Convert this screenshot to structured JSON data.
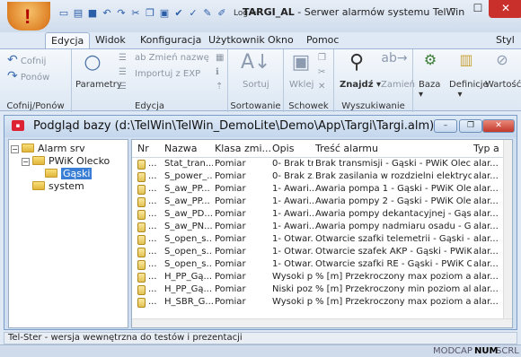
{
  "app": {
    "title_prefix": "TARGI_AL",
    "title_rest": " - Serwer alarmów systemu TelWin",
    "qat_log": "Log ="
  },
  "window_controls": {
    "minimize": "–",
    "maximize": "☐",
    "close": "✕"
  },
  "tabs": [
    "Edycja",
    "Widok",
    "Konfiguracja",
    "Użytkownik",
    "Okno",
    "Pomoc"
  ],
  "style_label": "Styl",
  "ribbon": {
    "cofnij": "Cofnij",
    "ponow": "Ponów",
    "group_cofnij": "Cofnij/Ponów",
    "parametry": "Parametry",
    "zmien_nazwe": "Zmień nazwę",
    "importuj": "Importuj z EXP",
    "group_edycja": "Edycja",
    "sortuj": "Sortuj",
    "group_sortowanie": "Sortowanie",
    "wklej": "Wklej",
    "group_schowek": "Schowek",
    "znajdz": "Znajdź",
    "zamien": "Zamień",
    "group_wyszukiwanie": "Wyszukiwanie",
    "baza": "Baza",
    "definicje": "Definicje",
    "wartosc": "Wartość"
  },
  "mdi": {
    "title": "Podgląd bazy (d:\\TelWin\\TelWin_DemoLite\\Demo\\App\\Targi\\Targi.alm)"
  },
  "tree": {
    "root": "Alarm srv",
    "child": "PWiK Olecko",
    "leaf": "Gąski",
    "system": "system"
  },
  "columns": [
    "Nr",
    "Nazwa",
    "Klasa zmi...",
    "Opis",
    "Treść alarmu",
    "Typ a"
  ],
  "rows": [
    [
      "...",
      "Stat_tran...",
      "Pomiar",
      "0- Brak tr...",
      "Brak transmisji - Gąski - PWiK Olecko",
      "alar..."
    ],
    [
      "...",
      "S_power_...",
      "Pomiar",
      "0- Brak z...",
      "Brak zasilania w rozdzielni elektrycznej - Gą...",
      "alar..."
    ],
    [
      "...",
      "S_aw_PP...",
      "Pomiar",
      "1- Awari...",
      "Awaria pompa 1 - Gąski - PWiK Olecko",
      "alar..."
    ],
    [
      "...",
      "S_aw_PP...",
      "Pomiar",
      "1- Awari...",
      "Awaria pompy 2 - Gąski - PWiK Olecko",
      "alar..."
    ],
    [
      "...",
      "S_aw_PD...",
      "Pomiar",
      "1- Awari...",
      "Awaria pompy dekantacyjnej - Gąski - PWi...",
      "alar..."
    ],
    [
      "...",
      "S_aw_PN...",
      "Pomiar",
      "1- Awari...",
      "Awaria pompy nadmiaru osadu - Gąski - P...",
      "alar..."
    ],
    [
      "...",
      "S_open_s...",
      "Pomiar",
      "1- Otwar...",
      "Otwarcie szafki telemetrii - Gąski - PWiK Ol...",
      "alar..."
    ],
    [
      "...",
      "S_open_s...",
      "Pomiar",
      "1- Otwar...",
      "Otwarcie szafek AKP - Gąski - PWiK Olecko",
      "alar..."
    ],
    [
      "...",
      "S_open_s...",
      "Pomiar",
      "1- Otwar...",
      "Otwarcie szafki RE - Gąski - PWiK Olecko",
      "alar..."
    ],
    [
      "...",
      "H_PP_Gą...",
      "Pomiar",
      "Wysoki p...",
      "% [m] Przekroczony max poziom alarmowy...",
      "alar..."
    ],
    [
      "...",
      "H_PP_Gą...",
      "Pomiar",
      "Niski poz...",
      "% [m] Przekroczony min poziom alarmowy...",
      "alar..."
    ],
    [
      "...",
      "H_SBR_G...",
      "Pomiar",
      "Wysoki p...",
      "% [m] Przekroczony max poziom alarmowy...",
      "alar..."
    ]
  ],
  "status_line": "Tel-Ster - wersja wewnętrzna do testów i prezentacji",
  "indicators": {
    "mod": "MOD",
    "cap": "CAP",
    "num": "NUM",
    "scrl": "SCRL"
  }
}
